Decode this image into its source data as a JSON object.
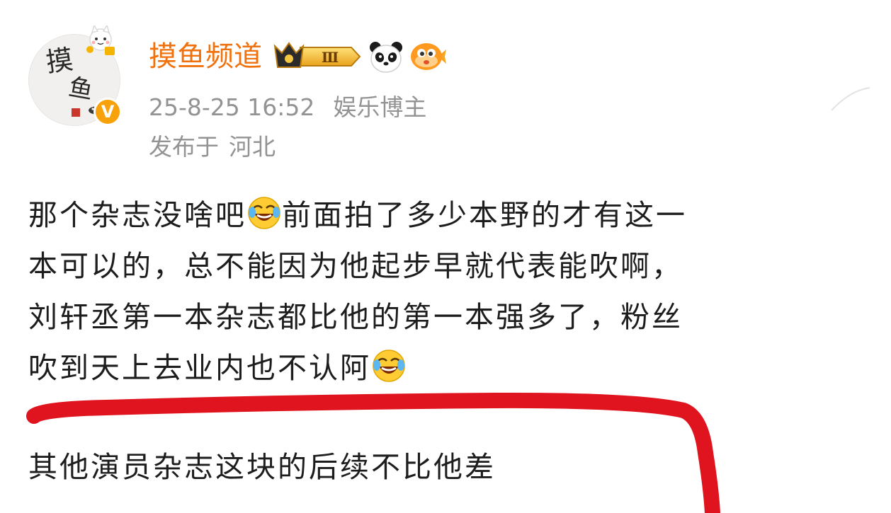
{
  "author": {
    "name": "摸鱼频道",
    "avatar_text_1": "摸",
    "avatar_text_2": "鱼",
    "verified_mark": "V",
    "level_mark": "Ⅲ",
    "name_color": "#f0720e"
  },
  "meta": {
    "timestamp": "25-8-25 16:52",
    "role": "娱乐博主",
    "location_prefix": "发布于",
    "location": "河北"
  },
  "post": {
    "lines": [
      {
        "before": "那个杂志没啥吧",
        "after": "前面拍了多少本野的才有这一"
      },
      {
        "text": "本可以的，总不能因为他起步早就代表能吹啊，"
      },
      {
        "text": "刘轩丞第一本杂志都比他的第一本强多了，粉丝"
      },
      {
        "before": "吹到天上去业内也不认阿",
        "after": ""
      }
    ],
    "annotation": "其他演员杂志这块的后续不比他差"
  },
  "icons": {
    "emoji": "laugh-cry-emoji",
    "panda": "panda-emoji",
    "fish": "puffer-fish-emoji",
    "badge": "crown-level-badge"
  },
  "colors": {
    "meta_text": "#939393",
    "body_text": "#1d1d1d",
    "annotation_stroke": "#e0141e",
    "verified": "#f7a20a"
  }
}
